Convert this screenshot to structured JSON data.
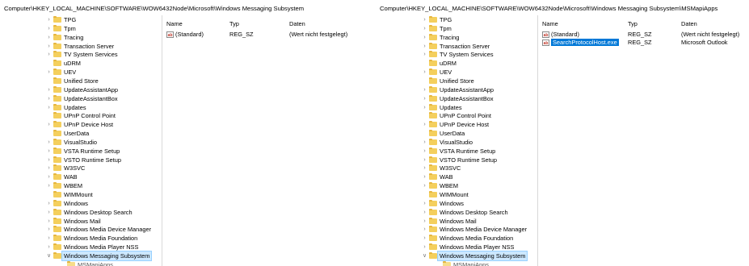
{
  "left": {
    "address": "Computer\\HKEY_LOCAL_MACHINE\\SOFTWARE\\WOW6432Node\\Microsoft\\Windows Messaging Subsystem",
    "columns": {
      "name": "Name",
      "type": "Typ",
      "data": "Daten"
    },
    "values": [
      {
        "icon": "string-value-icon",
        "name": "(Standard)",
        "type": "REG_SZ",
        "data": "(Wert nicht festgelegt)",
        "selected": false
      }
    ]
  },
  "right": {
    "address": "Computer\\HKEY_LOCAL_MACHINE\\SOFTWARE\\WOW6432Node\\Microsoft\\Windows Messaging Subsystem\\MSMapiApps",
    "columns": {
      "name": "Name",
      "type": "Typ",
      "data": "Daten"
    },
    "values": [
      {
        "icon": "string-value-icon",
        "name": "(Standard)",
        "type": "REG_SZ",
        "data": "(Wert nicht festgelegt)",
        "selected": false
      },
      {
        "icon": "string-value-icon",
        "name": "SearchProtocolHost.exe",
        "type": "REG_SZ",
        "data": "Microsoft Outlook",
        "selected": true
      }
    ]
  },
  "tree": {
    "items": [
      {
        "label": "TPG",
        "expandable": true
      },
      {
        "label": "Tpm",
        "expandable": true
      },
      {
        "label": "Tracing",
        "expandable": true
      },
      {
        "label": "Transaction Server",
        "expandable": true
      },
      {
        "label": "TV System Services",
        "expandable": true
      },
      {
        "label": "uDRM",
        "expandable": false
      },
      {
        "label": "UEV",
        "expandable": true
      },
      {
        "label": "Unified Store",
        "expandable": false
      },
      {
        "label": "UpdateAssistantApp",
        "expandable": true
      },
      {
        "label": "UpdateAssistantBox",
        "expandable": true
      },
      {
        "label": "Updates",
        "expandable": true
      },
      {
        "label": "UPnP Control Point",
        "expandable": false
      },
      {
        "label": "UPnP Device Host",
        "expandable": true
      },
      {
        "label": "UserData",
        "expandable": false
      },
      {
        "label": "VisualStudio",
        "expandable": true
      },
      {
        "label": "VSTA Runtime Setup",
        "expandable": true
      },
      {
        "label": "VSTO Runtime Setup",
        "expandable": true
      },
      {
        "label": "W3SVC",
        "expandable": true
      },
      {
        "label": "WAB",
        "expandable": true
      },
      {
        "label": "WBEM",
        "expandable": true
      },
      {
        "label": "WIMMount",
        "expandable": false
      },
      {
        "label": "Windows",
        "expandable": true
      },
      {
        "label": "Windows Desktop Search",
        "expandable": true
      },
      {
        "label": "Windows Mail",
        "expandable": true
      },
      {
        "label": "Windows Media Device Manager",
        "expandable": true
      },
      {
        "label": "Windows Media Foundation",
        "expandable": true
      },
      {
        "label": "Windows Media Player NSS",
        "expandable": true
      },
      {
        "label": "Windows Messaging Subsystem",
        "expandable": true,
        "expanded": true
      }
    ],
    "child_left": "MSMapiApps",
    "child_right": "MSMapiApps"
  }
}
